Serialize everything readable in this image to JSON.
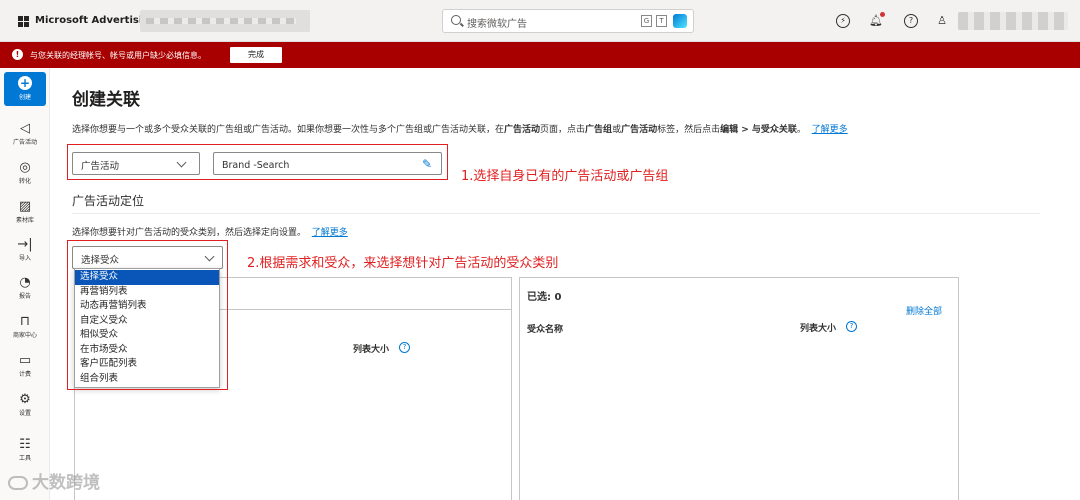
{
  "topbar": {
    "brand": "Microsoft Advertising",
    "search_placeholder": "搜索微软广告",
    "kbd_g": "G",
    "kbd_t": "T",
    "icons": [
      "copilot-icon",
      "bell-icon",
      "help-icon",
      "user-icon"
    ]
  },
  "alert": {
    "text": "与您关联的经理帐号、帐号或用户缺少必填信息。",
    "button": "完成",
    "color": "#a80000"
  },
  "rail": {
    "create": "创建",
    "items": [
      {
        "label": "广告活动",
        "icon": "megaphone-icon"
      },
      {
        "label": "转化",
        "icon": "target-icon"
      },
      {
        "label": "素材库",
        "icon": "media-icon"
      },
      {
        "label": "导入",
        "icon": "import-icon"
      },
      {
        "label": "报告",
        "icon": "report-icon"
      },
      {
        "label": "商家中心",
        "icon": "store-icon"
      },
      {
        "label": "计费",
        "icon": "wallet-icon"
      },
      {
        "label": "设置",
        "icon": "gear-icon"
      },
      {
        "label": "工具",
        "icon": "tools-icon"
      }
    ]
  },
  "main": {
    "title": "创建关联",
    "intro_1": "选择你想要与一个或多个受众关联的广告组或广告活动。如果你想要一次性与多个广告组或广告活动关联，在",
    "intro_b1": "广告活动",
    "intro_2": "页面，点击",
    "intro_b2": "广告组",
    "intro_3": "或",
    "intro_b3": "广告活动",
    "intro_4": "标签，然后点击",
    "intro_b4": "编辑 > 与受众关联",
    "intro_5": "。",
    "intro_link": "了解更多",
    "level_select": "广告活动",
    "campaign_value": "Brand -Search",
    "section_title": "广告活动定位",
    "target_desc": "选择你想要针对广告活动的受众类别，然后选择定向设置。",
    "target_link": "了解更多",
    "audience_select": "选择受众",
    "audience_options": [
      "选择受众",
      "再营销列表",
      "动态再营销列表",
      "自定义受众",
      "相似受众",
      "在市场受众",
      "客户匹配列表",
      "组合列表"
    ],
    "left_col_size": "列表大小",
    "selected_label": "已选: 0",
    "clear_all": "删除全部",
    "right_col_name": "受众名称",
    "right_col_size": "列表大小"
  },
  "annotations": {
    "step1": "1.选择自身已有的广告活动或广告组",
    "step2": "2.根据需求和受众，来选择想针对广告活动的受众类别",
    "color": "#e02020"
  },
  "watermark": "大数跨境"
}
